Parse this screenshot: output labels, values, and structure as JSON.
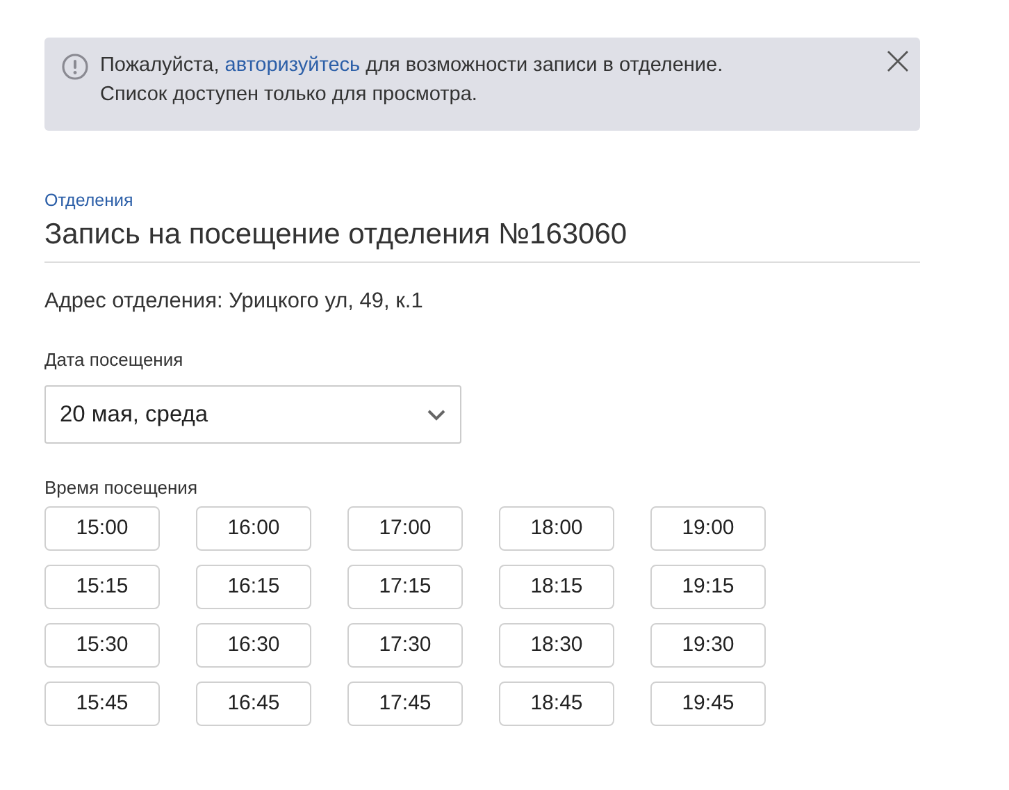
{
  "alert": {
    "before": "Пожалуйста, ",
    "link": "авторизуйтесь",
    "after": " для возможности записи в отделение.",
    "note": "Список доступен только для просмотра."
  },
  "breadcrumb": "Отделения",
  "title": "Запись на посещение отделения №163060",
  "address": "Адрес отделения: Урицкого ул, 49, к.1",
  "date": {
    "label": "Дата посещения",
    "value": "20 мая, среда"
  },
  "time": {
    "label": "Время посещения",
    "slots": [
      [
        "15:00",
        "16:00",
        "17:00",
        "18:00",
        "19:00"
      ],
      [
        "15:15",
        "16:15",
        "17:15",
        "18:15",
        "19:15"
      ],
      [
        "15:30",
        "16:30",
        "17:30",
        "18:30",
        "19:30"
      ],
      [
        "15:45",
        "16:45",
        "17:45",
        "18:45",
        "19:45"
      ]
    ]
  }
}
